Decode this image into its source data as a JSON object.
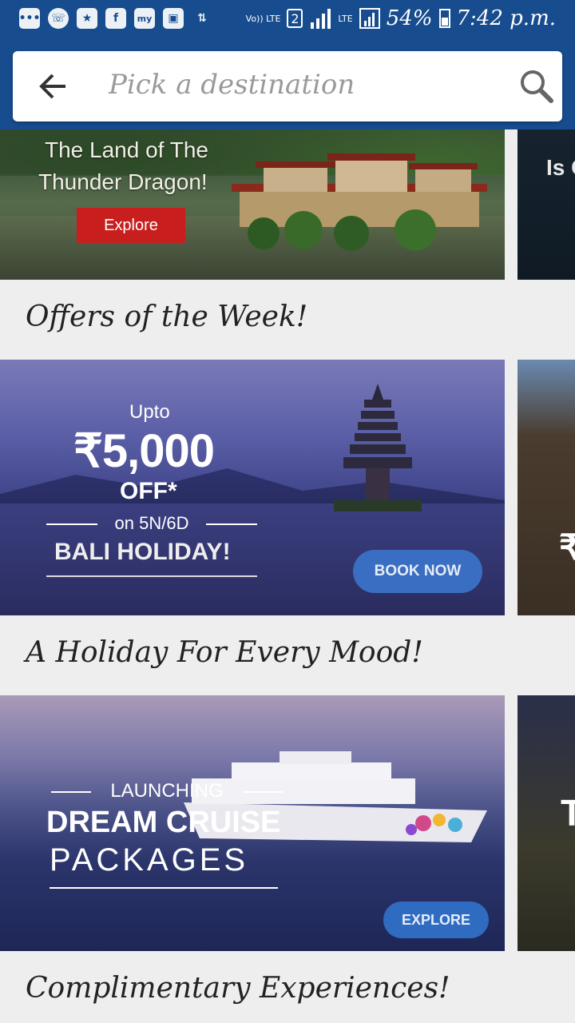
{
  "status_bar": {
    "network_label": "Vo)) LTE",
    "sim": "2",
    "data_label": "LTE",
    "battery": "54%",
    "time": "7:42 p.m.",
    "notification_icons": [
      "messages-icon",
      "whatsapp-icon",
      "star-app-icon",
      "facebook-icon",
      "my-app-icon",
      "gallery-icon",
      "transfer-icon"
    ]
  },
  "search": {
    "placeholder": "Pick a destination"
  },
  "banners": {
    "bhutan": {
      "line1": "The Land of The",
      "line2": "Thunder Dragon!",
      "button": "Explore"
    },
    "peek1": {
      "text": "Is C"
    },
    "offers_title": "Offers of the Week!",
    "bali": {
      "upto": "Upto",
      "price": "₹5,000",
      "off": "OFF*",
      "duration": "on 5N/6D",
      "name": "BALI HOLIDAY!",
      "button": "BOOK NOW"
    },
    "peek2": {
      "text": "₹"
    },
    "mood_title": "A Holiday For Every Mood!",
    "cruise": {
      "launching": "LAUNCHING",
      "title": "DREAM CRUISE",
      "subtitle": "PACKAGES",
      "button": "EXPLORE"
    },
    "peek3": {
      "text": "T"
    },
    "complimentary_title": "Complimentary Experiences!"
  },
  "colors": {
    "header": "#174c8e",
    "background": "#eeeeee",
    "explore_red": "#c81e1e",
    "cta_blue": "#3a6ec2"
  }
}
